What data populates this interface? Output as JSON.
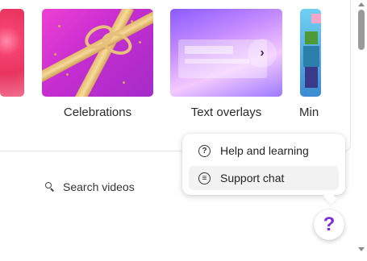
{
  "templates": {
    "tiles": [
      {
        "caption": ""
      },
      {
        "caption": "Celebrations"
      },
      {
        "caption": "Text overlays"
      },
      {
        "caption": "Min"
      }
    ],
    "next_glyph": "›"
  },
  "search": {
    "label": "Search videos"
  },
  "help_menu": {
    "items": [
      {
        "label": "Help and learning",
        "icon": "question-circle-icon",
        "glyph": "?"
      },
      {
        "label": "Support chat",
        "icon": "chat-bubble-icon",
        "glyph": "≡"
      }
    ],
    "highlight_color": "#f7f000"
  },
  "help_button": {
    "glyph": "?",
    "color": "#7b2fd6"
  }
}
